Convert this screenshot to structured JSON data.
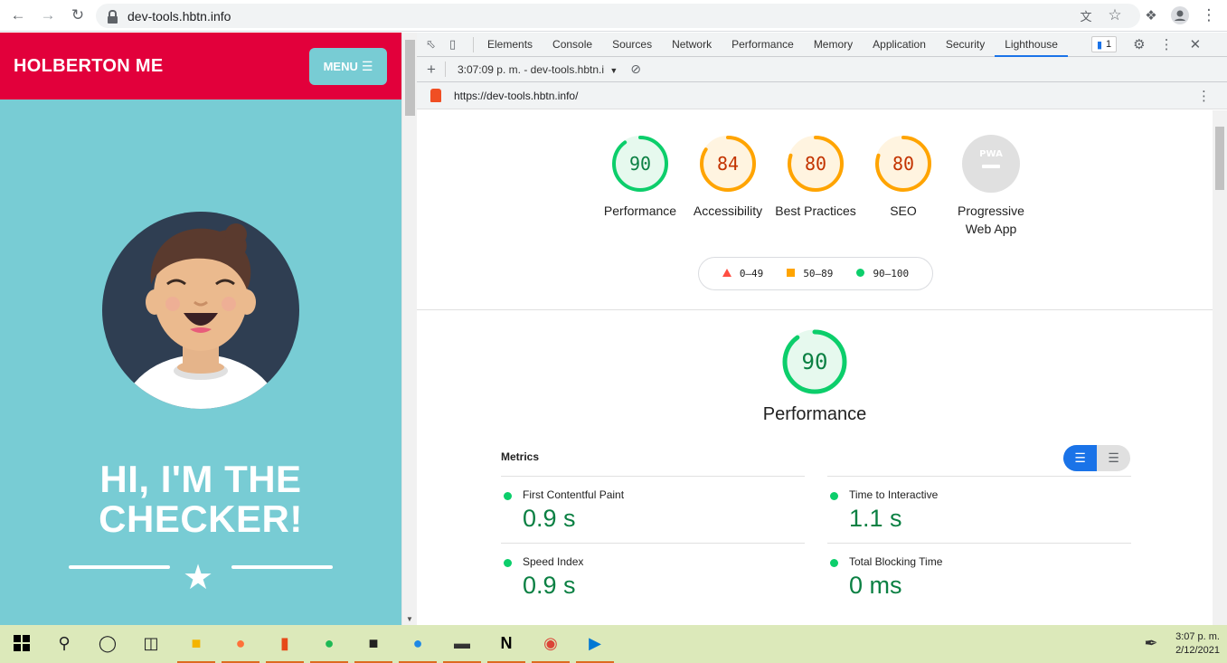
{
  "browser": {
    "url": "dev-tools.hbtn.info"
  },
  "page": {
    "logo": "HOLBERTON ME",
    "menu_label": "MENU",
    "hero_line1": "HI, I'M THE",
    "hero_line2": "CHECKER!"
  },
  "devtools": {
    "tabs": [
      "Elements",
      "Console",
      "Sources",
      "Network",
      "Performance",
      "Memory",
      "Application",
      "Security",
      "Lighthouse"
    ],
    "active_tab": "Lighthouse",
    "issues_count": "1",
    "report_select": "3:07:09 p. m. - dev-tools.hbtn.i",
    "report_url": "https://dev-tools.hbtn.info/"
  },
  "lighthouse": {
    "scores": [
      {
        "label": "Performance",
        "value": "90",
        "fraction": 0.9,
        "color": "#0cce6b",
        "text": "#0b8043",
        "bg": "#e6f9ee"
      },
      {
        "label": "Accessibility",
        "value": "84",
        "fraction": 0.84,
        "color": "#ffa400",
        "text": "#c33300",
        "bg": "#fff4e0"
      },
      {
        "label": "Best Practices",
        "value": "80",
        "fraction": 0.8,
        "color": "#ffa400",
        "text": "#c33300",
        "bg": "#fff4e0"
      },
      {
        "label": "SEO",
        "value": "80",
        "fraction": 0.8,
        "color": "#ffa400",
        "text": "#c33300",
        "bg": "#fff4e0"
      },
      {
        "label": "Progressive Web App",
        "value": "PWA",
        "fraction": 0,
        "color": "#e0e0e0",
        "text": "#fff",
        "bg": "#e0e0e0"
      }
    ],
    "legend": {
      "fail": "0–49",
      "average": "50–89",
      "pass": "90–100"
    },
    "section_score": "90",
    "section_title": "Performance",
    "metrics_heading": "Metrics",
    "metrics": [
      {
        "label": "First Contentful Paint",
        "value": "0.9 s"
      },
      {
        "label": "Time to Interactive",
        "value": "1.1 s"
      },
      {
        "label": "Speed Index",
        "value": "0.9 s"
      },
      {
        "label": "Total Blocking Time",
        "value": "0 ms"
      }
    ],
    "colors": {
      "pass": "#0cce6b",
      "average": "#ffa400",
      "fail": "#ff4e42"
    }
  },
  "taskbar": {
    "time": "3:07 p. m.",
    "date": "2/12/2021"
  }
}
